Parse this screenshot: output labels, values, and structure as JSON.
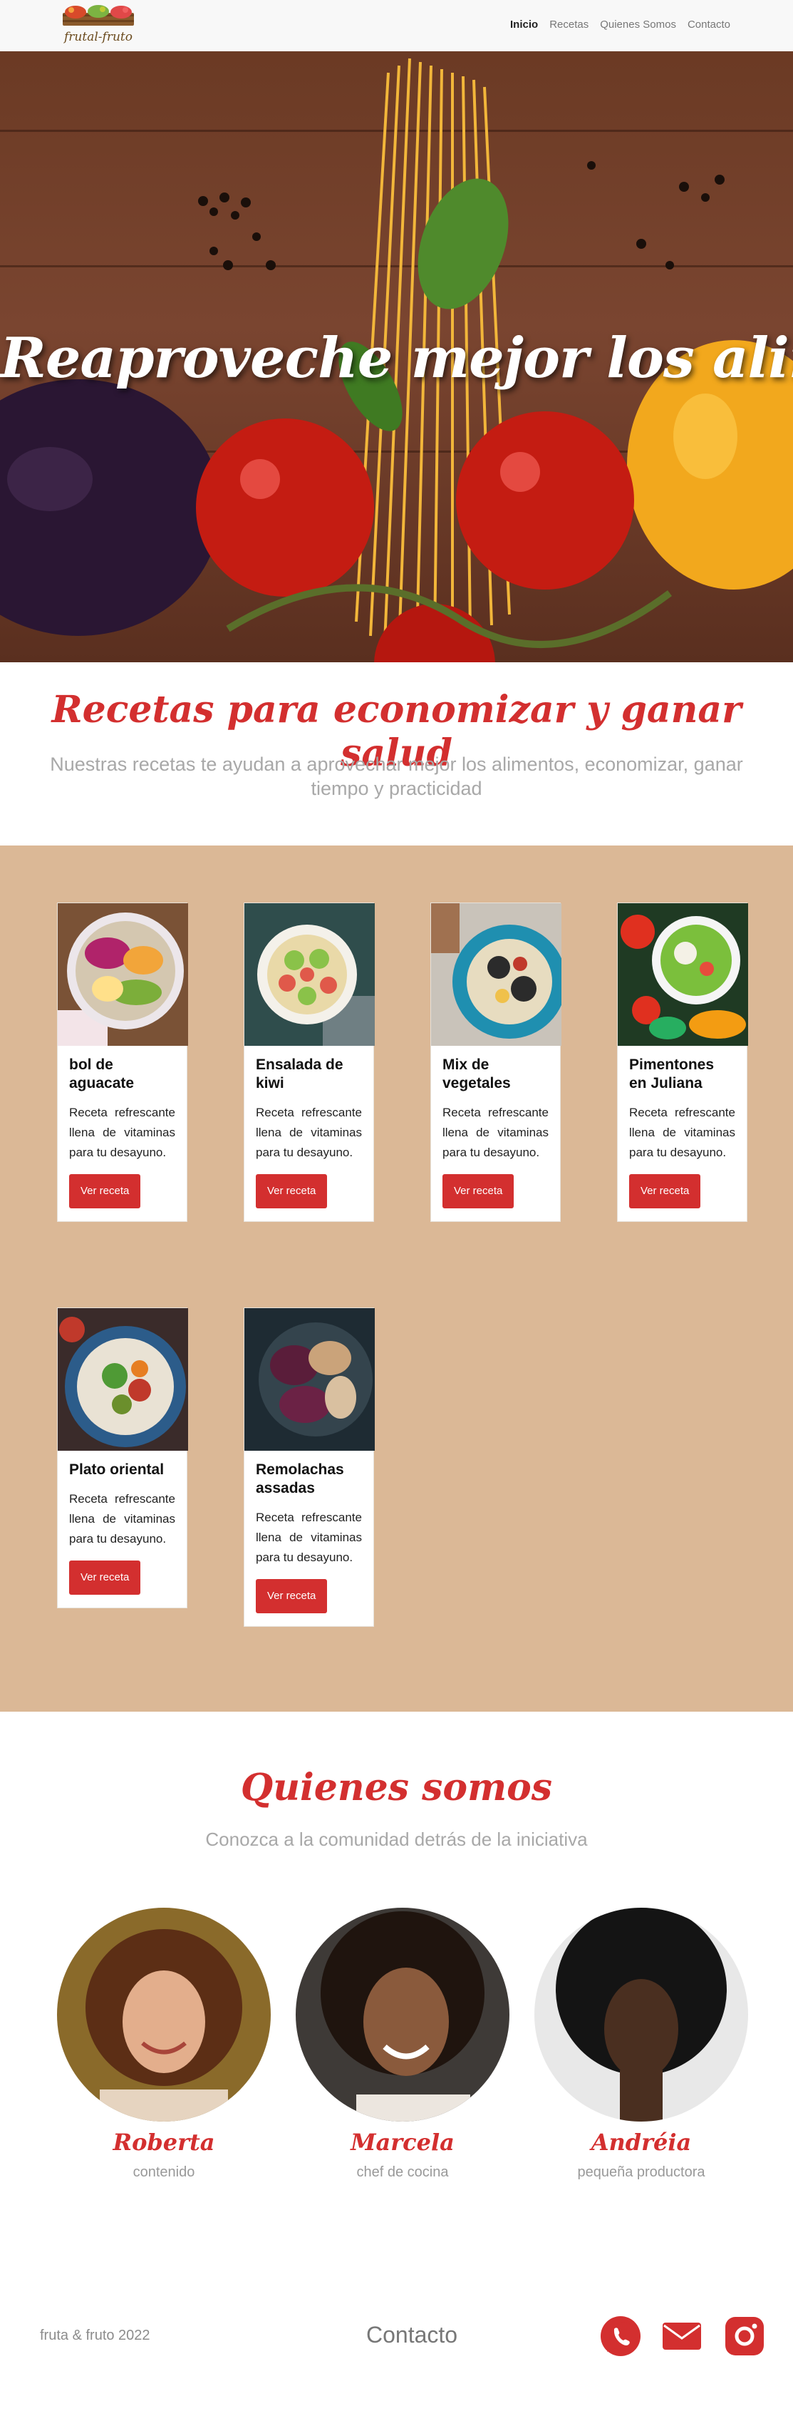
{
  "brand": {
    "logo_text": "frutal-fruto"
  },
  "nav": {
    "items": [
      {
        "label": "Inicio",
        "active": true
      },
      {
        "label": "Recetas"
      },
      {
        "label": "Quienes Somos"
      },
      {
        "label": "Contacto"
      }
    ]
  },
  "hero": {
    "title": "Reaproveche mejor los alimentos"
  },
  "recipes_intro": {
    "title": "Recetas para economizar y ganar salud",
    "subtitle": "Nuestras recetas te ayudan a aprovechar mejor los alimentos, economizar, ganar tiempo y practicidad"
  },
  "recipes": [
    {
      "title": "bol de aguacate",
      "text": "Receta refrescante llena de vitaminas para tu desayuno.",
      "button": "Ver receta"
    },
    {
      "title": "Ensalada de kiwi",
      "text": "Receta refrescante llena de vitaminas para tu desayuno.",
      "button": "Ver receta"
    },
    {
      "title": "Mix de vegetales",
      "text": "Receta refrescante llena de vitaminas para tu desayuno.",
      "button": "Ver receta"
    },
    {
      "title": "Pimentones en Juliana",
      "text": "Receta refrescante llena de vitaminas para tu desayuno.",
      "button": "Ver receta"
    },
    {
      "title": "Plato oriental",
      "text": "Receta refrescante llena de vitaminas para tu desayuno.",
      "button": "Ver receta"
    },
    {
      "title": "Remolachas assadas",
      "text": "Receta refrescante llena de vitaminas para tu desayuno.",
      "button": "Ver receta"
    }
  ],
  "about": {
    "title": "Quienes somos",
    "subtitle": "Conozca a la comunidad detrás de la iniciativa",
    "members": [
      {
        "name": "Roberta",
        "role": "contenido"
      },
      {
        "name": "Marcela",
        "role": "chef de cocina"
      },
      {
        "name": "Andréia",
        "role": "pequeña productora"
      }
    ]
  },
  "footer": {
    "copyright": "fruta & fruto 2022",
    "contact_label": "Contacto",
    "icons": [
      "whatsapp-icon",
      "email-icon",
      "instagram-icon"
    ]
  },
  "colors": {
    "accent": "#d32f2f",
    "recipes_bg": "#dbb896",
    "navbar_bg": "#f8f8f8"
  }
}
